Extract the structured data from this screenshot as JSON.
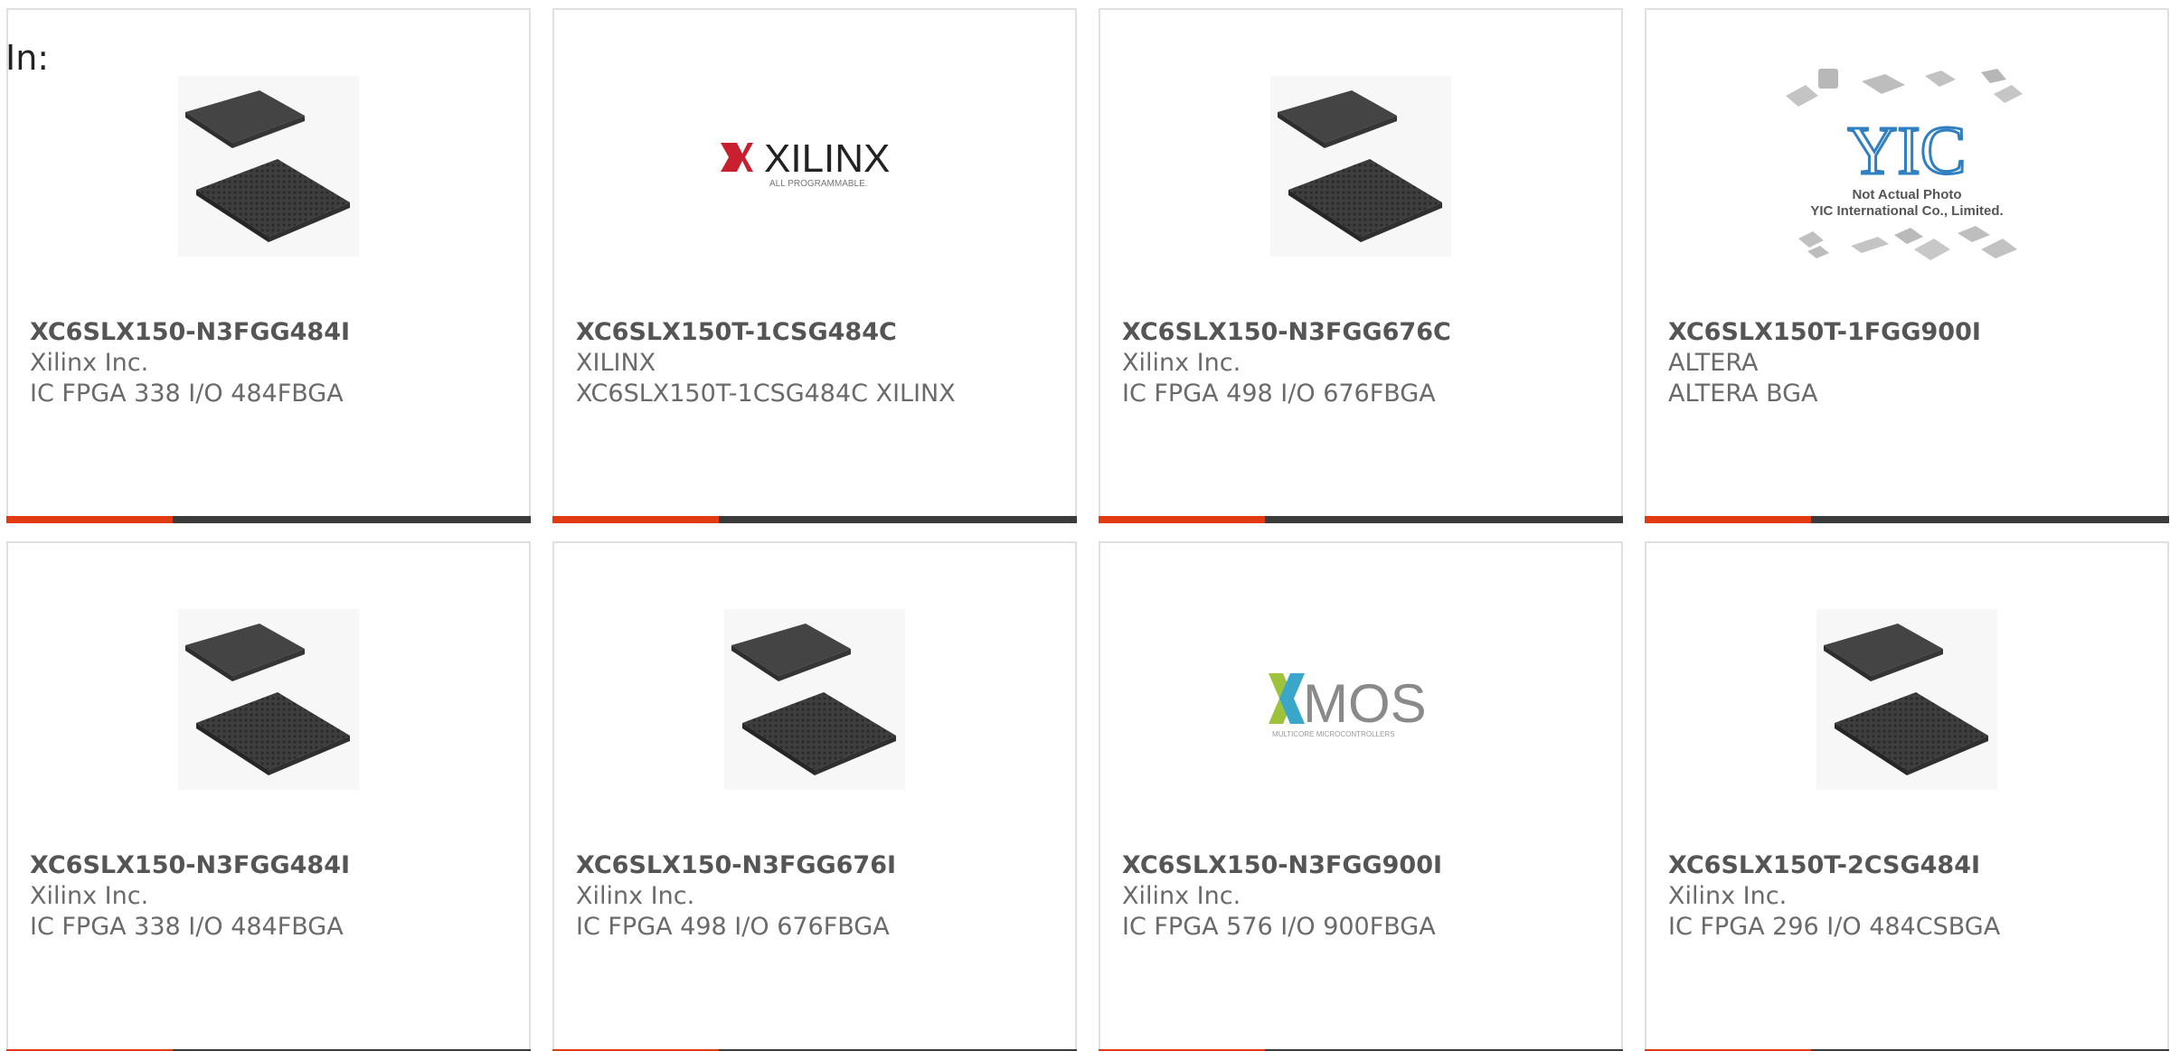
{
  "page_label": "In:",
  "colors": {
    "accent_bar": "#e23a12",
    "dark_bar": "#3b3b3b",
    "card_border": "#e0e0e0",
    "text_primary": "#555555",
    "text_secondary": "#6a6a6a"
  },
  "products": [
    {
      "part": "XC6SLX150-N3FGG484I",
      "manufacturer": "Xilinx Inc.",
      "description": "IC FPGA 338 I/O 484FBGA",
      "image": "bga-chip-image"
    },
    {
      "part": "XC6SLX150T-1CSG484C",
      "manufacturer": "XILINX",
      "description": "XC6SLX150T-1CSG484C XILINX",
      "image": "xilinx-logo",
      "logo_text": "XILINX",
      "logo_tagline": "ALL PROGRAMMABLE."
    },
    {
      "part": "XC6SLX150-N3FGG676C",
      "manufacturer": "Xilinx Inc.",
      "description": "IC FPGA 498 I/O 676FBGA",
      "image": "bga-chip-image"
    },
    {
      "part": "XC6SLX150T-1FGG900I",
      "manufacturer": "ALTERA",
      "description": "ALTERA BGA",
      "image": "yic-placeholder",
      "logo_text": "YIC",
      "logo_line1": "Not Actual Photo",
      "logo_line2": "YIC International Co., Limited."
    },
    {
      "part": "XC6SLX150-N3FGG484I",
      "manufacturer": "Xilinx Inc.",
      "description": "IC FPGA 338 I/O 484FBGA",
      "image": "bga-chip-image"
    },
    {
      "part": "XC6SLX150-N3FGG676I",
      "manufacturer": "Xilinx Inc.",
      "description": "IC FPGA 498 I/O 676FBGA",
      "image": "bga-chip-image"
    },
    {
      "part": "XC6SLX150-N3FGG900I",
      "manufacturer": "Xilinx Inc.",
      "description": "IC FPGA 576 I/O 900FBGA",
      "image": "xmos-logo",
      "logo_text": "MOS",
      "logo_tagline": "MULTICORE MICROCONTROLLERS"
    },
    {
      "part": "XC6SLX150T-2CSG484I",
      "manufacturer": "Xilinx Inc.",
      "description": "IC FPGA 296 I/O 484CSBGA",
      "image": "bga-chip-image"
    }
  ]
}
